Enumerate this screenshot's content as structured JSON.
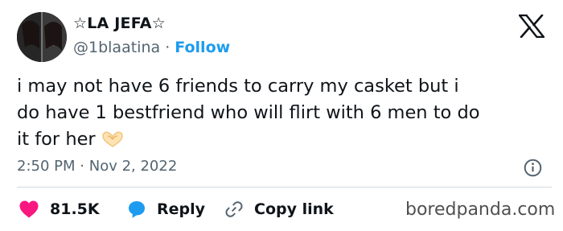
{
  "author": {
    "display_name": "☆LA JEFA☆",
    "handle": "@1blaatina",
    "separator": "·",
    "follow_label": "Follow"
  },
  "tweet": {
    "text_lines": [
      "i may not have 6 friends to carry my casket but i",
      "do have 1 bestfriend who will flirt with 6 men to do",
      "it for her"
    ],
    "emoji": "heart-hands"
  },
  "timestamp": {
    "time": "2:50 PM",
    "separator": "·",
    "date": "Nov 2, 2022"
  },
  "actions": {
    "like_count": "81.5K",
    "reply_label": "Reply",
    "copy_link_label": "Copy link"
  },
  "watermark": "boredpanda.com",
  "icons": {
    "brand": "x-logo-icon",
    "info": "info-icon",
    "like": "heart-icon",
    "reply": "reply-bubble-icon",
    "copy": "link-icon"
  },
  "colors": {
    "like": "#f91880",
    "link": "#1d9bf0",
    "secondary_text": "#536471",
    "divider": "#cfd9de"
  }
}
